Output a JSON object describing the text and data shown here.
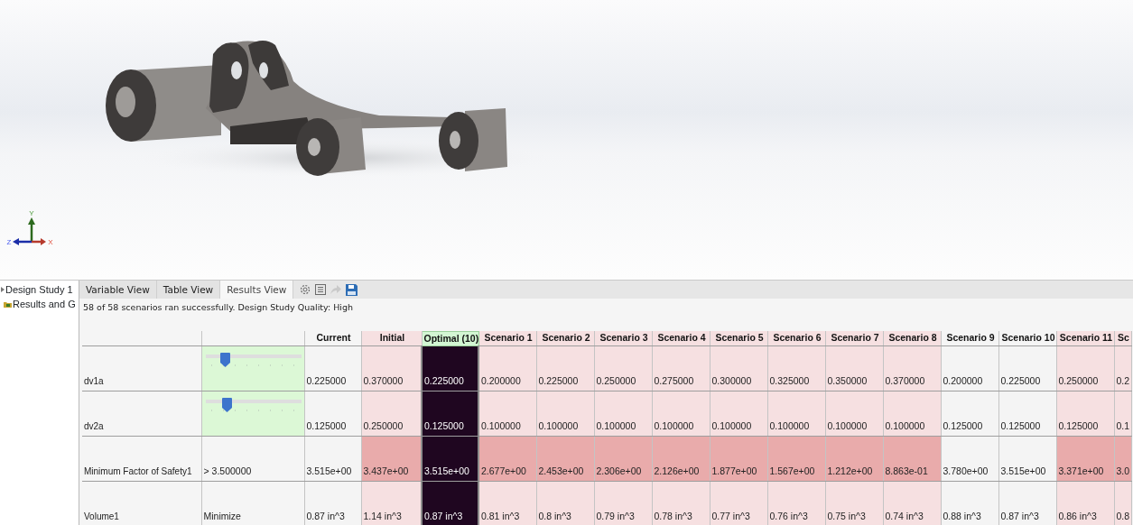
{
  "viewport": {
    "triad": {
      "y": "Y",
      "z": "Z",
      "x": "X"
    }
  },
  "tree": [
    {
      "label": "Design Study 1",
      "children": [
        {
          "label": "Results and G"
        }
      ]
    }
  ],
  "tabs": [
    {
      "label": "Variable View",
      "selected": false
    },
    {
      "label": "Table View",
      "selected": false
    },
    {
      "label": "Results View",
      "selected": true
    }
  ],
  "toolbar": [
    {
      "kind": "gear",
      "disabled": false
    },
    {
      "kind": "list",
      "disabled": false
    },
    {
      "kind": "arrow",
      "disabled": true
    },
    {
      "kind": "save",
      "disabled": false
    }
  ],
  "status": "58 of 58 scenarios ran successfully. Design Study Quality: High",
  "table": {
    "columns": [
      {
        "header": "Current",
        "feasible": true,
        "selected": false
      },
      {
        "header": "Initial",
        "feasible": false,
        "selected": false
      },
      {
        "header": "Optimal (10)",
        "feasible": true,
        "selected": true
      },
      {
        "header": "Scenario 1",
        "feasible": false,
        "selected": false
      },
      {
        "header": "Scenario 2",
        "feasible": false,
        "selected": false
      },
      {
        "header": "Scenario 3",
        "feasible": false,
        "selected": false
      },
      {
        "header": "Scenario 4",
        "feasible": false,
        "selected": false
      },
      {
        "header": "Scenario 5",
        "feasible": false,
        "selected": false
      },
      {
        "header": "Scenario 6",
        "feasible": false,
        "selected": false
      },
      {
        "header": "Scenario 7",
        "feasible": false,
        "selected": false
      },
      {
        "header": "Scenario 8",
        "feasible": false,
        "selected": false
      },
      {
        "header": "Scenario 9",
        "feasible": true,
        "selected": false
      },
      {
        "header": "Scenario 10",
        "feasible": true,
        "selected": false
      },
      {
        "header": "Scenario 11",
        "feasible": false,
        "selected": false
      },
      {
        "header": "Sc",
        "feasible": false,
        "selected": false
      }
    ],
    "rows": [
      {
        "name": "dv1a",
        "kind": "variable",
        "setting": {
          "level": 0.2
        },
        "values": [
          "0.225000",
          "0.370000",
          "0.225000",
          "0.200000",
          "0.225000",
          "0.250000",
          "0.275000",
          "0.300000",
          "0.325000",
          "0.350000",
          "0.370000",
          "0.200000",
          "0.225000",
          "0.250000",
          "0.2"
        ]
      },
      {
        "name": "dv2a",
        "kind": "variable",
        "setting": {
          "level": 0.22
        },
        "values": [
          "0.125000",
          "0.250000",
          "0.125000",
          "0.100000",
          "0.100000",
          "0.100000",
          "0.100000",
          "0.100000",
          "0.100000",
          "0.100000",
          "0.100000",
          "0.125000",
          "0.125000",
          "0.125000",
          "0.1"
        ]
      },
      {
        "name": "Minimum Factor of Safety1",
        "kind": "constraint",
        "setting": {
          "text": "> 3.500000"
        },
        "values": [
          "3.515e+00",
          "3.437e+00",
          "3.515e+00",
          "2.677e+00",
          "2.453e+00",
          "2.306e+00",
          "2.126e+00",
          "1.877e+00",
          "1.567e+00",
          "1.212e+00",
          "8.863e-01",
          "3.780e+00",
          "3.515e+00",
          "3.371e+00",
          "3.0"
        ]
      },
      {
        "name": "Volume1",
        "kind": "goal",
        "setting": {
          "text": "Minimize"
        },
        "values": [
          "0.87 in^3",
          "1.14 in^3",
          "0.87 in^3",
          "0.81 in^3",
          "0.8 in^3",
          "0.79 in^3",
          "0.78 in^3",
          "0.77 in^3",
          "0.76 in^3",
          "0.75 in^3",
          "0.74 in^3",
          "0.88 in^3",
          "0.87 in^3",
          "0.86 in^3",
          "0.8"
        ]
      }
    ]
  }
}
